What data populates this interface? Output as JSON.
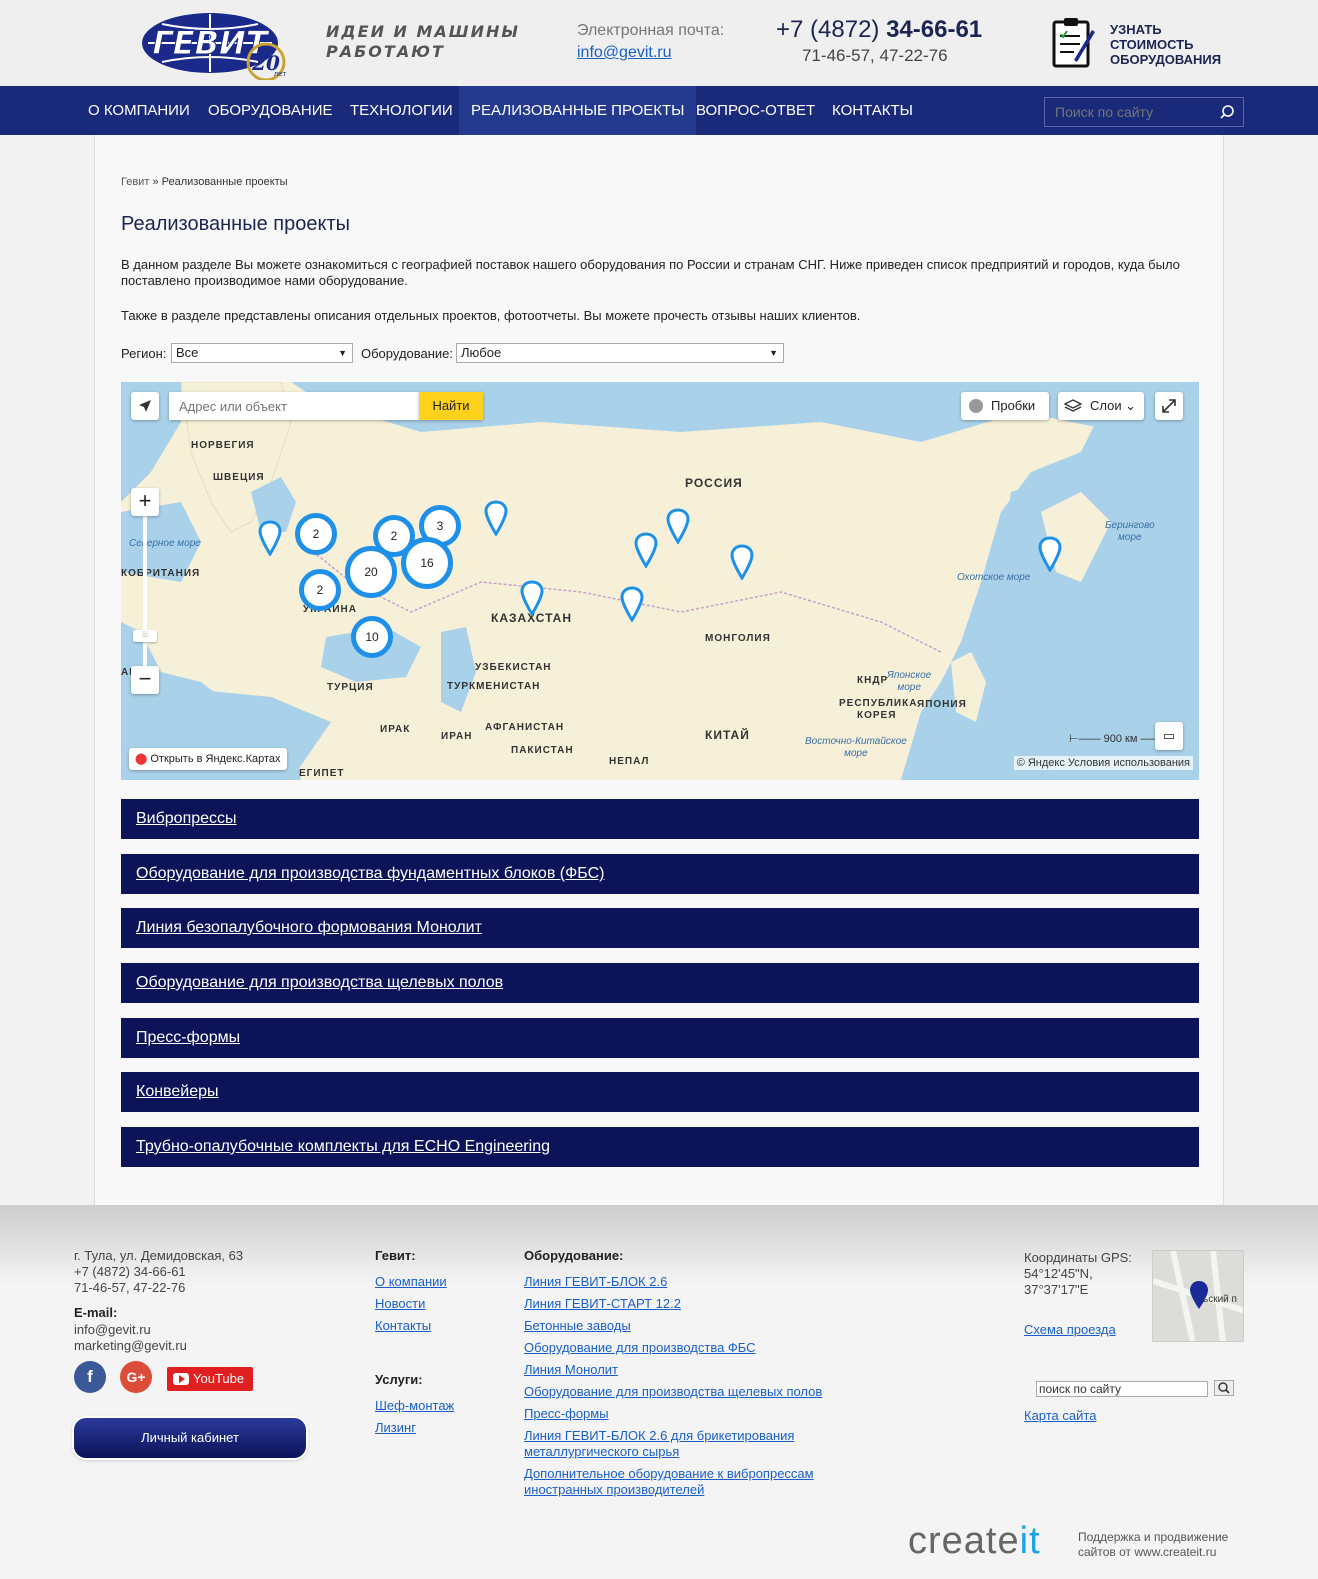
{
  "header": {
    "logo_text": "ГЕВИТ",
    "logo_years": "20",
    "logo_years_label": "лет",
    "slogan_line1": "идеи и машины",
    "slogan_line2": "работают",
    "email_label": "Электронная почта:",
    "email": "info@gevit.ru",
    "phone_prefix": "+7 (4872) ",
    "phone_main": "34-66-61",
    "phone_sub": "71-46-57, 47-22-76",
    "price_cta_1": "Узнать",
    "price_cta_2": "стоимость",
    "price_cta_3": "оборудования"
  },
  "nav": {
    "items": [
      "О компании",
      "Оборудование",
      "Технологии",
      "Реализованные проекты",
      "Вопрос-ответ",
      "Контакты"
    ],
    "active_index": 3,
    "search_placeholder": "Поиск по сайту"
  },
  "breadcrumb": {
    "home": "Гевит",
    "separator": "»",
    "current": "Реализованные проекты"
  },
  "page": {
    "title": "Реализованные проекты",
    "intro": "В данном разделе Вы можете ознакомиться с географией поставок нашего оборудования по России и странам СНГ. Ниже приведен список предприятий и городов, куда было поставлено производимое нами оборудование.",
    "intro2": "Также в разделе представлены описания отдельных проектов, фотоотчеты. Вы можете прочесть отзывы наших клиентов."
  },
  "filters": {
    "region_label": "Регион:",
    "region_value": "Все",
    "equipment_label": "Оборудование:",
    "equipment_value": "Любое"
  },
  "map": {
    "address_placeholder": "Адрес или объект",
    "find_label": "Найти",
    "traffic_label": "Пробки",
    "layers_label": "Слои",
    "open_yandex": "Открыть в Яндекс.Картах",
    "scale_label": "900 км",
    "copyright_prefix": "© Яндекс",
    "terms_link": "Условия использования",
    "labels": {
      "russia": "РОССИЯ",
      "norway": "НОРВЕГИЯ",
      "sweden": "ШВЕЦИЯ",
      "north_sea": "Северное море",
      "britain": "КОБРИТАНИЯ",
      "ukraine": "УКРАИНА",
      "turkey": "ТУРЦИЯ",
      "kazakhstan": "КАЗАХСТАН",
      "uzbekistan": "УЗБЕКИСТАН",
      "turkmenistan": "ТУРКМЕНИСТАН",
      "mongolia": "МОНГОЛИЯ",
      "china": "КИТАЙ",
      "iraq": "ИРАК",
      "iran": "ИРАН",
      "afghanistan": "АФГАНИСТАН",
      "pakistan": "ПАКИСТАН",
      "nepal": "НЕПАЛ",
      "egypt": "ЕГИПЕТ",
      "dprk": "КНДР",
      "korea_1": "РЕСПУБЛИКА",
      "korea_2": "КОРЕЯ",
      "japan": "ЯПОНИЯ",
      "japan_sea_1": "Японское",
      "japan_sea_2": "море",
      "okhotsk_sea": "Охотское море",
      "bering_sea_1": "Берингово",
      "bering_sea_2": "море",
      "east_china_sea_1": "Восточно-Китайское",
      "east_china_sea_2": "море",
      "ah": "АН"
    },
    "clusters": [
      {
        "count": "2"
      },
      {
        "count": "2"
      },
      {
        "count": "3"
      },
      {
        "count": "20"
      },
      {
        "count": "16"
      },
      {
        "count": "2"
      },
      {
        "count": "10"
      }
    ]
  },
  "categories": [
    "Вибропрессы",
    "Оборудование для производства фундаментных блоков (ФБС)",
    "Линия безопалубочного формования Монолит",
    "Оборудование для производства щелевых полов",
    "Пресс-формы",
    "Конвейеры",
    "Трубно-опалубочные комплекты для ECHO Engineering"
  ],
  "footer": {
    "address": "г. Тула, ул. Демидовская, 63",
    "phone1": "+7 (4872) 34-66-61",
    "phone2": "71-46-57, 47-22-76",
    "email_label": "E-mail:",
    "email1": "info@gevit.ru",
    "email2": "marketing@gevit.ru",
    "youtube": "YouTube",
    "cabinet": "Личный кабинет",
    "gevit_head": "Гевит:",
    "gevit_links": [
      "О компании",
      "Новости",
      "Контакты"
    ],
    "services_head": "Услуги:",
    "services_links": [
      "Шеф-монтаж",
      "Лизинг"
    ],
    "equipment_head": "Оборудование:",
    "equipment_links": [
      "Линия ГЕВИТ-БЛОК 2.6",
      "Линия ГЕВИТ-СТАРТ 12.2",
      "Бетонные заводы",
      "Оборудование для производства ФБС",
      "Линия Монолит",
      "Оборудование для производства щелевых полов",
      "Пресс-формы",
      "Линия ГЕВИТ-БЛОК 2.6 для брикетирования",
      "металлургического сырья",
      "Дополнительное оборудование к вибропрессам",
      "иностранных производителей"
    ],
    "gps_label": "Координаты GPS:",
    "gps_n": "54°12'45\"N,",
    "gps_e": "37°37'17\"E",
    "route_link": "Схема проезда",
    "map_street": "ьский п",
    "search_value": "поиск по сайту",
    "sitemap": "Карта сайта",
    "createit_a": "create",
    "createit_b": "it",
    "createit_sub1": "Поддержка и продвижение",
    "createit_sub2": "сайтов от www.createit.ru"
  },
  "colors": {
    "nav_bg": "#1a2a7a",
    "category_bar": "#0c1358",
    "link": "#1a5fc7",
    "cluster": "#1e90e8",
    "find_button": "#ffd21e"
  }
}
